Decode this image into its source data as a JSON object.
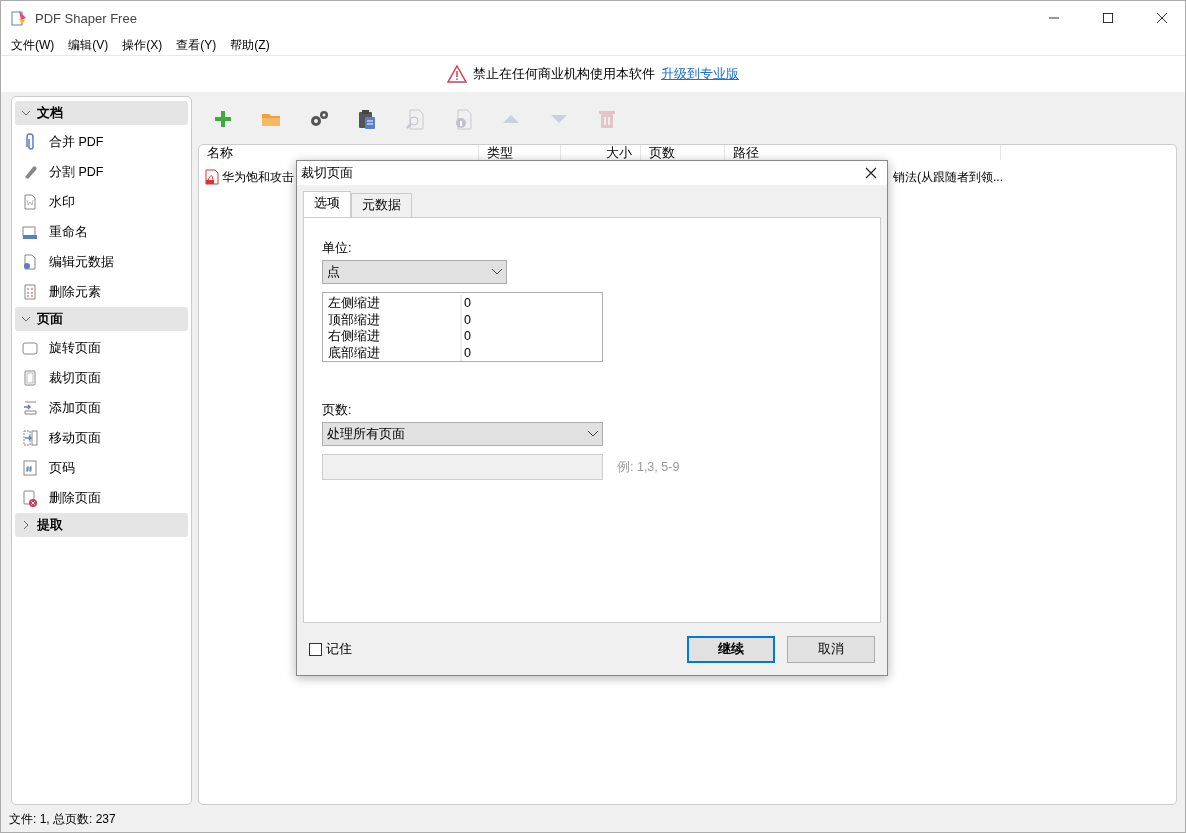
{
  "window": {
    "title": "PDF Shaper Free"
  },
  "menu": [
    "文件(W)",
    "编辑(V)",
    "操作(X)",
    "查看(Y)",
    "帮助(Z)"
  ],
  "banner": {
    "text": "禁止在任何商业机构使用本软件",
    "link": "升级到专业版"
  },
  "sidebar": [
    {
      "label": "文档",
      "expanded": true,
      "items": [
        "合并 PDF",
        "分割 PDF",
        "水印",
        "重命名",
        "编辑元数据",
        "删除元素"
      ]
    },
    {
      "label": "页面",
      "expanded": true,
      "items": [
        "旋转页面",
        "裁切页面",
        "添加页面",
        "移动页面",
        "页码",
        "删除页面"
      ]
    },
    {
      "label": "提取",
      "expanded": false
    }
  ],
  "toolbar": [
    {
      "disabled": false
    },
    {
      "disabled": false
    },
    {
      "disabled": false
    },
    {
      "disabled": false
    },
    {
      "disabled": true
    },
    {
      "disabled": true
    },
    {
      "disabled": true
    },
    {
      "disabled": true
    },
    {
      "disabled": true
    }
  ],
  "table": {
    "columns": [
      "名称",
      "类型",
      "大小",
      "页数",
      "路径"
    ],
    "rows": [
      {
        "name": "华为饱和攻击",
        "path": "销法(从跟随者到领..."
      }
    ]
  },
  "dialog": {
    "title": "裁切页面",
    "tabs": [
      {
        "label": "选项",
        "selected": true
      },
      {
        "label": "元数据",
        "selected": false
      }
    ],
    "unit_label": "单位:",
    "unit_value": "点",
    "margins": [
      {
        "label": "左侧缩进",
        "value": "0"
      },
      {
        "label": "顶部缩进",
        "value": "0"
      },
      {
        "label": "右侧缩进",
        "value": "0"
      },
      {
        "label": "底部缩进",
        "value": "0"
      }
    ],
    "pages_label": "页数:",
    "pages_value": "处理所有页面",
    "range_hint": "例: 1,3, 5-9",
    "remember": {
      "label": "记住",
      "checked": false
    },
    "buttons": [
      {
        "label": "继续",
        "default": true
      },
      {
        "label": "取消",
        "default": false
      }
    ]
  },
  "status_bar": "文件: 1, 总页数: 237"
}
